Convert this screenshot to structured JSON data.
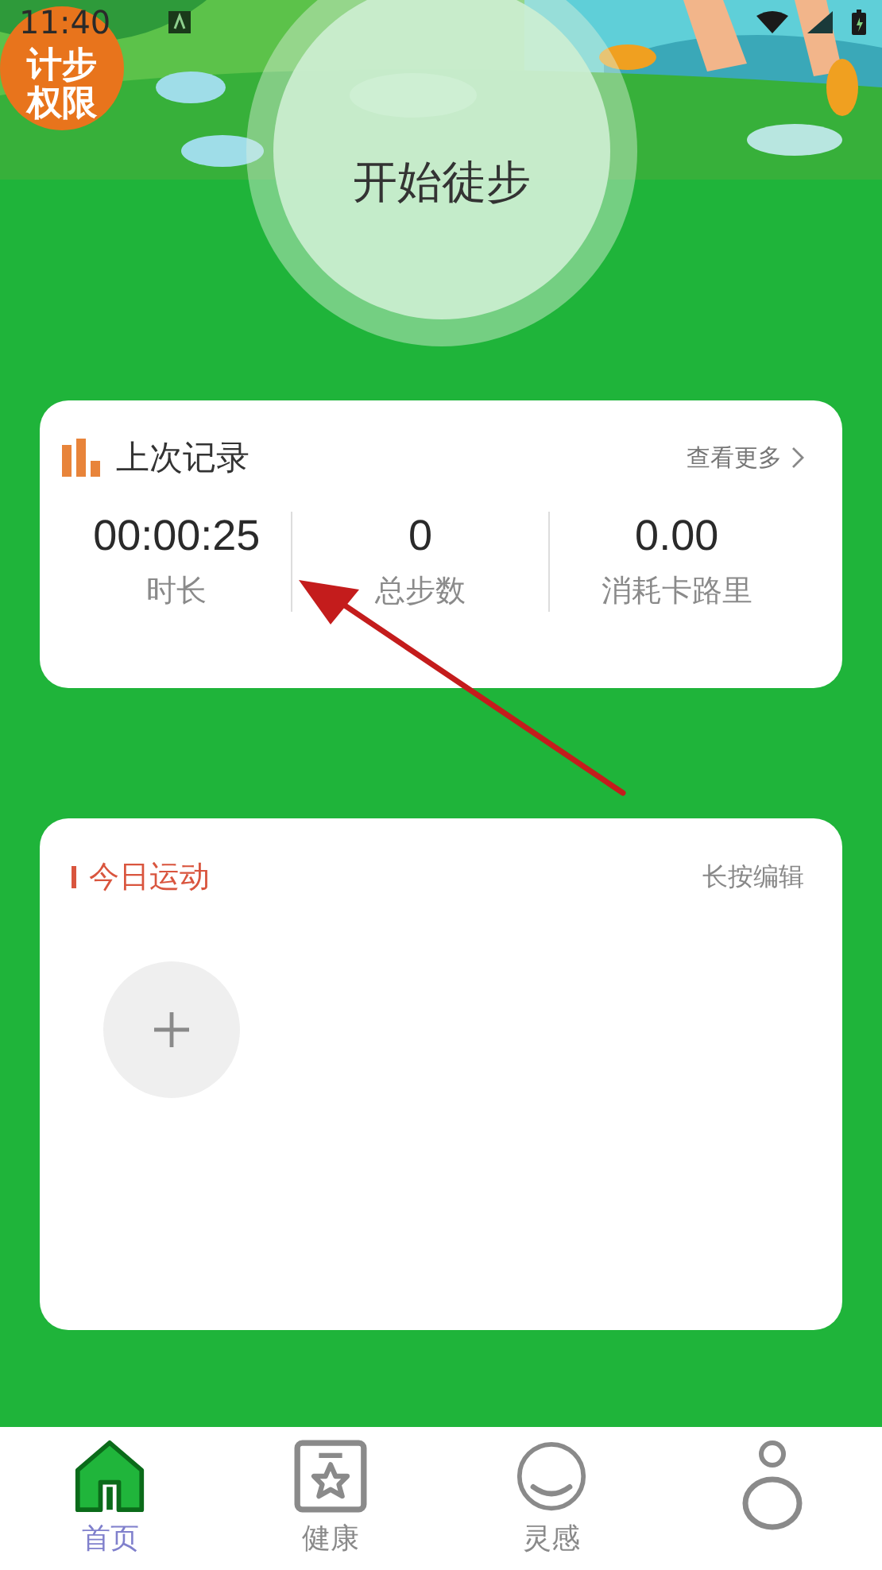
{
  "status_bar": {
    "time": "11:40"
  },
  "permission_badge": {
    "label": "计步权限"
  },
  "start_button": {
    "label": "开始徒步"
  },
  "last_record": {
    "title": "上次记录",
    "more_link": "查看更多",
    "stats": [
      {
        "value": "00:00:25",
        "label": "时长"
      },
      {
        "value": "0",
        "label": "总步数"
      },
      {
        "value": "0.00",
        "label": "消耗卡路里"
      }
    ]
  },
  "today": {
    "title": "今日运动",
    "hint": "长按编辑"
  },
  "annotation": {
    "kind": "arrow"
  },
  "nav": [
    {
      "kind": "home",
      "label": "首页",
      "selected": true
    },
    {
      "kind": "health",
      "label": "健康",
      "selected": false
    },
    {
      "kind": "smile",
      "label": "灵感",
      "selected": false
    },
    {
      "kind": "person",
      "selected": false
    }
  ]
}
